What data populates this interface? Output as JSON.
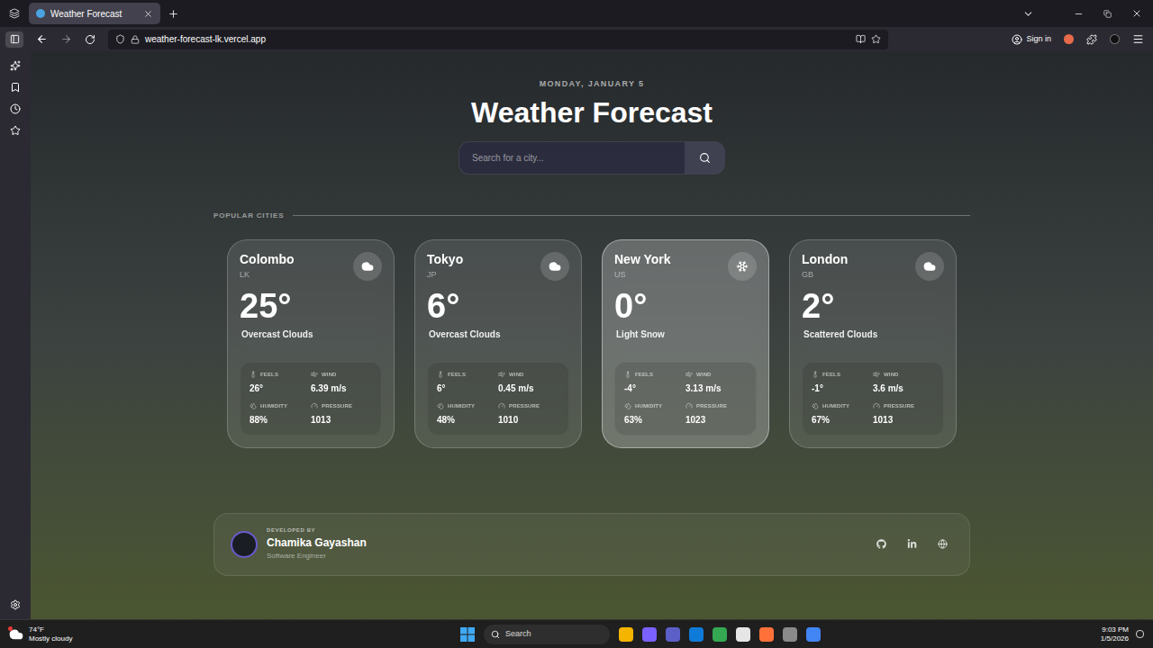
{
  "browser": {
    "tab": {
      "title": "Weather Forecast",
      "selected": true
    },
    "url": "weather-forecast-lk.vercel.app",
    "sign_in": "Sign in"
  },
  "page": {
    "date": "MONDAY, JANUARY 5",
    "title": "Weather Forecast",
    "search": {
      "placeholder": "Search for a city..."
    },
    "section_label": "POPULAR CITIES",
    "stat_labels": {
      "feels": "FEELS",
      "wind": "WIND",
      "humidity": "HUMIDITY",
      "pressure": "PRESSURE"
    },
    "cities": [
      {
        "name": "Colombo",
        "country": "LK",
        "temp": "25°",
        "condition": "Overcast Clouds",
        "kind": "clouds",
        "feels": "26°",
        "wind": "6.39 m/s",
        "humidity": "88%",
        "pressure": "1013",
        "selected": false
      },
      {
        "name": "Tokyo",
        "country": "JP",
        "temp": "6°",
        "condition": "Overcast Clouds",
        "kind": "clouds",
        "feels": "6°",
        "wind": "0.45 m/s",
        "humidity": "48%",
        "pressure": "1010",
        "selected": false
      },
      {
        "name": "New York",
        "country": "US",
        "temp": "0°",
        "condition": "Light Snow",
        "kind": "snow",
        "feels": "-4°",
        "wind": "3.13 m/s",
        "humidity": "63%",
        "pressure": "1023",
        "selected": true
      },
      {
        "name": "London",
        "country": "GB",
        "temp": "2°",
        "condition": "Scattered Clouds",
        "kind": "clouds",
        "feels": "-1°",
        "wind": "3.6 m/s",
        "humidity": "67%",
        "pressure": "1013",
        "selected": false
      }
    ],
    "footer": {
      "label": "DEVELOPED BY",
      "name": "Chamika Gayashan",
      "role": "Software Engineer"
    }
  },
  "taskbar": {
    "weather": {
      "temp": "74°F",
      "condition": "Mostly cloudy"
    },
    "search": "Search",
    "time": "9:03 PM",
    "date": "1/5/2026"
  }
}
